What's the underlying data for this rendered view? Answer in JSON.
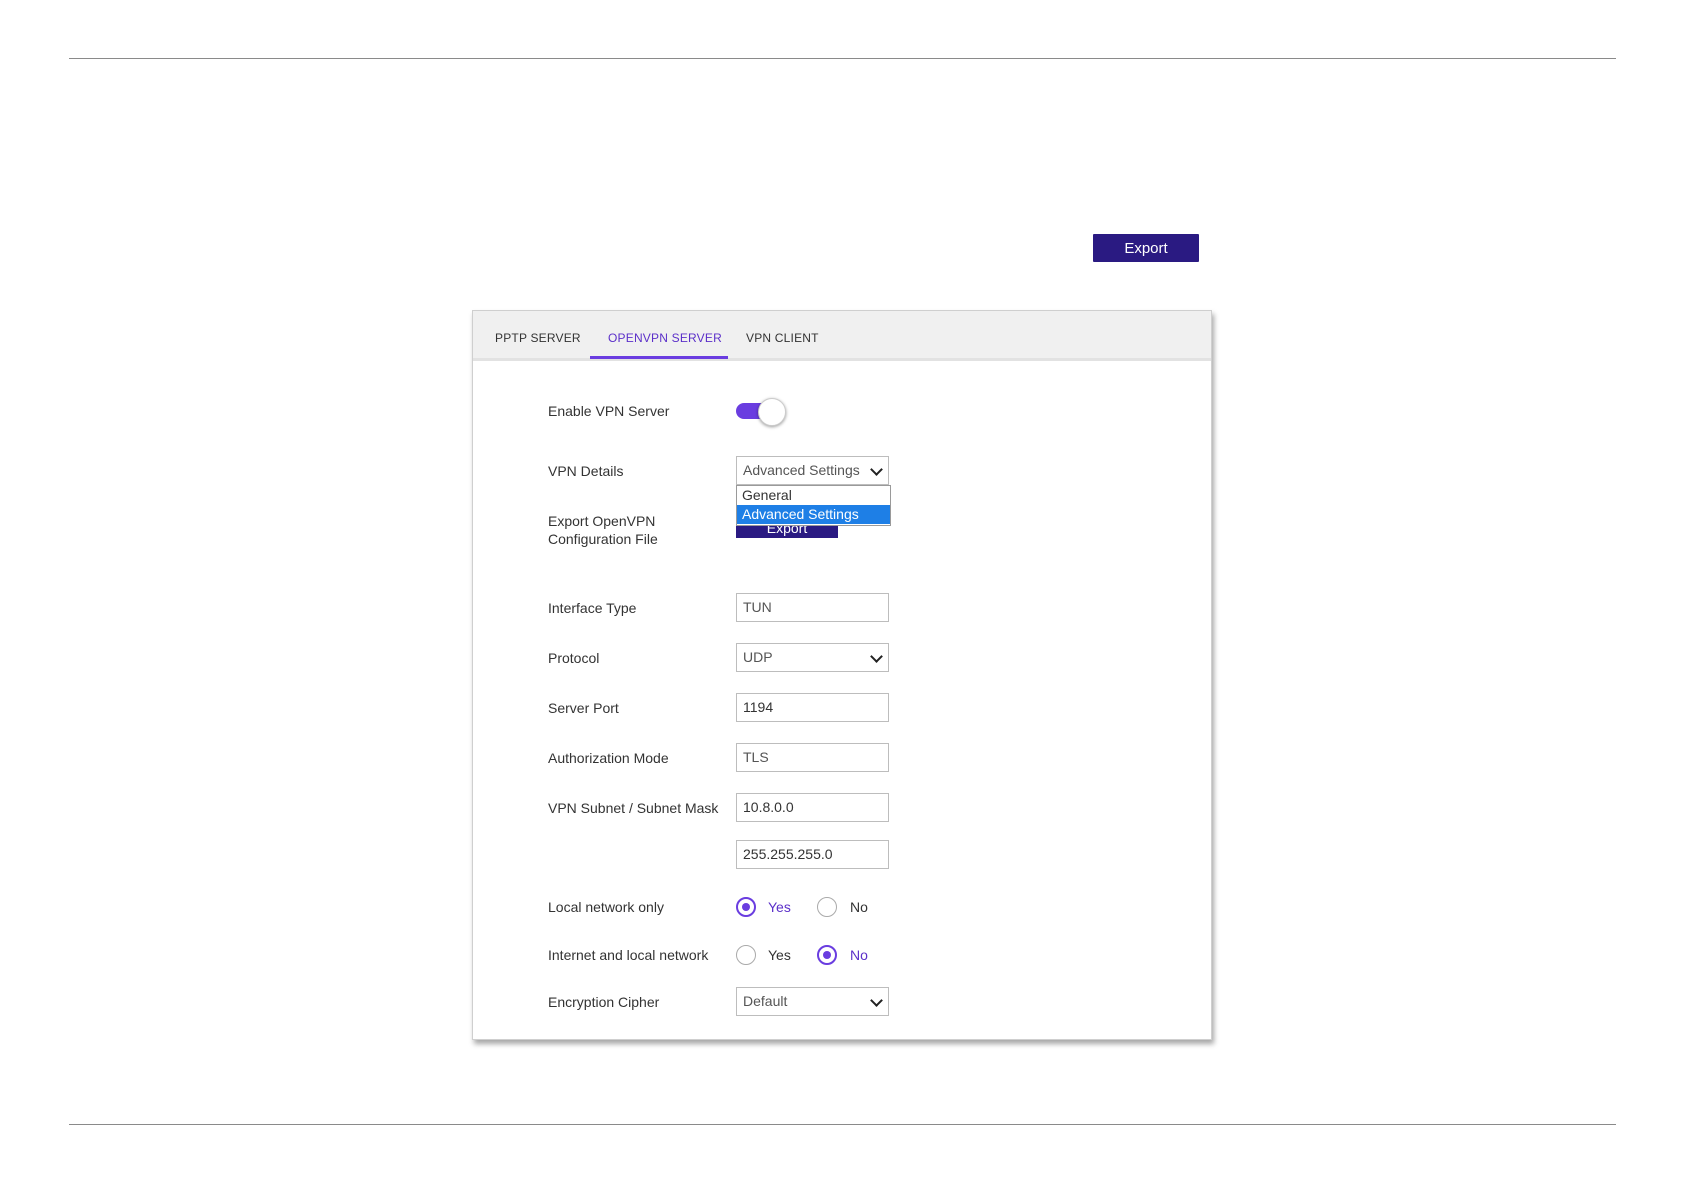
{
  "toolbar": {
    "export_label": "Export"
  },
  "tabs": [
    {
      "label": "PPTP SERVER",
      "active": false
    },
    {
      "label": "OPENVPN SERVER",
      "active": true
    },
    {
      "label": "VPN CLIENT",
      "active": false
    }
  ],
  "form": {
    "enable_vpn_server": {
      "label": "Enable VPN Server",
      "enabled": true
    },
    "vpn_details": {
      "label": "VPN Details",
      "value": "Advanced Settings",
      "options": [
        "General",
        "Advanced Settings"
      ],
      "selected": "Advanced Settings"
    },
    "export_config": {
      "label_line1": "Export OpenVPN",
      "label_line2": "Configuration File",
      "button_label": "Export"
    },
    "interface_type": {
      "label": "Interface Type",
      "value": "TUN"
    },
    "protocol": {
      "label": "Protocol",
      "value": "UDP"
    },
    "server_port": {
      "label": "Server Port",
      "value": "1194"
    },
    "authorization_mode": {
      "label": "Authorization Mode",
      "value": "TLS"
    },
    "vpn_subnet": {
      "label": "VPN Subnet / Subnet Mask",
      "subnet": "10.8.0.0",
      "mask": "255.255.255.0"
    },
    "local_network_only": {
      "label": "Local network only",
      "yes": "Yes",
      "no": "No",
      "selected": "Yes"
    },
    "internet_and_local": {
      "label": "Internet and local network",
      "yes": "Yes",
      "no": "No",
      "selected": "No"
    },
    "encryption_cipher": {
      "label": "Encryption Cipher",
      "value": "Default"
    }
  },
  "colors": {
    "accent": "#6a3de0",
    "button": "#2a1a82",
    "dropdown_selected": "#1e7fe6"
  }
}
